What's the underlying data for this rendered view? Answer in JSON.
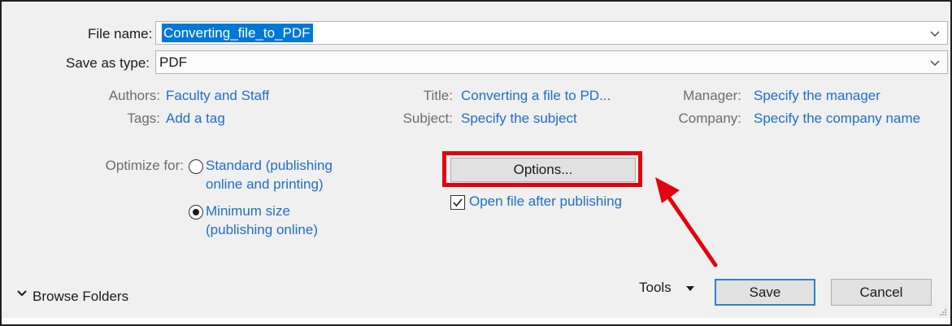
{
  "file_name": {
    "label": "File name:",
    "value": "Converting_file_to_PDF"
  },
  "save_as_type": {
    "label": "Save as type:",
    "value": "PDF"
  },
  "metadata": {
    "authors_label": "Authors:",
    "authors_value": "Faculty and Staff",
    "tags_label": "Tags:",
    "tags_value": "Add a tag",
    "title_label": "Title:",
    "title_value": "Converting a file to PD...",
    "subject_label": "Subject:",
    "subject_value": "Specify the subject",
    "manager_label": "Manager:",
    "manager_value": "Specify the manager",
    "company_label": "Company:",
    "company_value": "Specify the company name"
  },
  "optimize": {
    "label": "Optimize for:",
    "options": [
      {
        "line1": "Standard (publishing",
        "line2": "online and printing)",
        "selected": false
      },
      {
        "line1": "Minimum size",
        "line2": "(publishing online)",
        "selected": true
      }
    ]
  },
  "options_button": "Options...",
  "open_after_publishing": {
    "label": "Open file after publishing",
    "checked": true
  },
  "browse_folders": "Browse Folders",
  "tools": "Tools",
  "save_button": "Save",
  "cancel_button": "Cancel",
  "colors": {
    "link": "#1f6fc6",
    "selection": "#0078d7",
    "highlight_annotation": "#e3000f",
    "primary_border": "#2f7fd6",
    "dialog_background": "#f0f0f0"
  },
  "icons": {
    "dropdown": "chevron-down-icon",
    "expand": "chevron-down-icon",
    "tools_menu": "caret-down-icon",
    "checkbox": "checkmark-icon",
    "annotation": "red-arrow-icon",
    "resize": "resize-grip-icon"
  }
}
